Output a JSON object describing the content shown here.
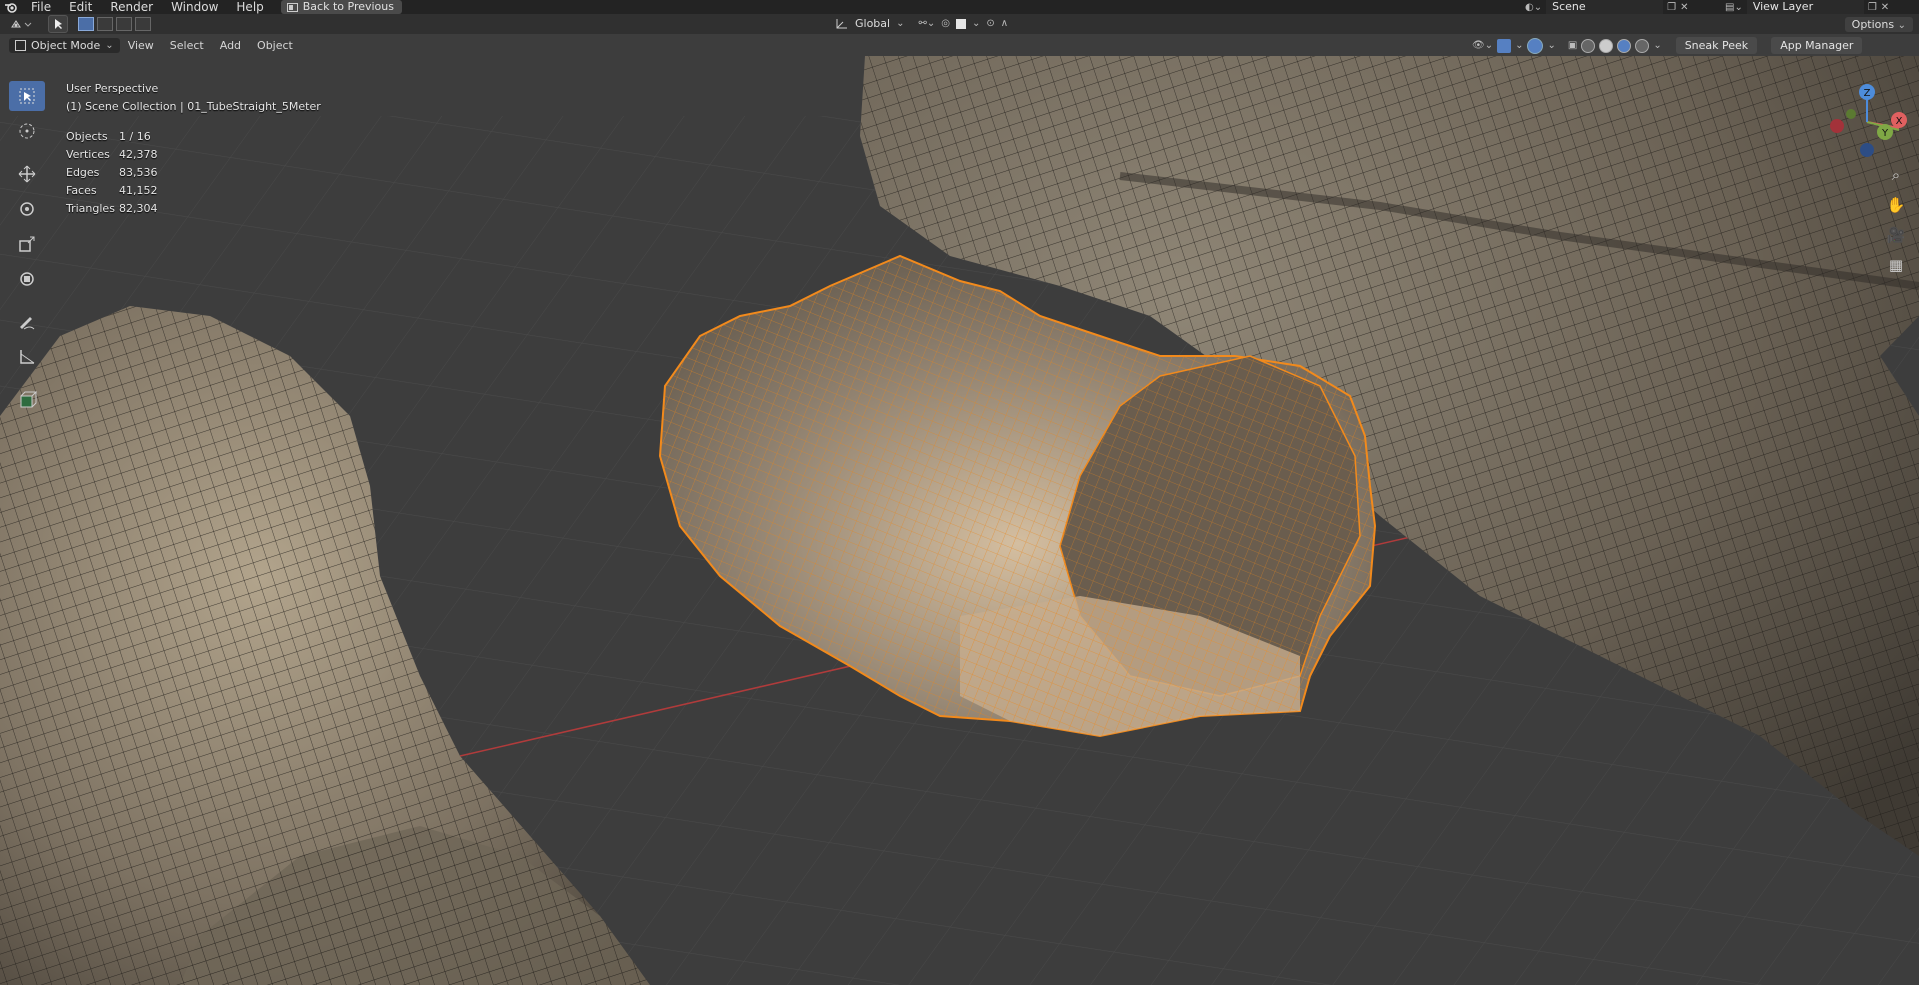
{
  "menu": [
    "File",
    "Edit",
    "Render",
    "Window",
    "Help"
  ],
  "back_to_previous": "Back to Previous",
  "scene": {
    "value": "Scene"
  },
  "view_layer": {
    "value": "View Layer"
  },
  "header": {
    "orientation": "Global",
    "options_label": "Options"
  },
  "viewport_header": {
    "mode": "Object Mode",
    "menus": [
      "View",
      "Select",
      "Add",
      "Object"
    ],
    "sneak_peek": "Sneak Peek",
    "app_manager": "App Manager"
  },
  "overlay_text": {
    "perspective": "User Perspective",
    "collection": "(1) Scene Collection | 01_TubeStraight_5Meter",
    "stats": [
      {
        "k": "Objects",
        "v": "1 / 16"
      },
      {
        "k": "Vertices",
        "v": "42,378"
      },
      {
        "k": "Edges",
        "v": "83,536"
      },
      {
        "k": "Faces",
        "v": "41,152"
      },
      {
        "k": "Triangles",
        "v": "82,304"
      }
    ]
  },
  "gizmo": {
    "x": "X",
    "y": "Y",
    "z": "Z"
  },
  "colors": {
    "selection": "#f28a1c",
    "accent": "#4b6ea7",
    "rock_light": "#a89a85",
    "rock_dark": "#564e44"
  },
  "tools": [
    "select-tool-icon",
    "cursor-tool-icon",
    "move-tool-icon",
    "rotate-tool-icon",
    "scale-tool-icon",
    "transform-tool-icon",
    "annotate-tool-icon",
    "measure-tool-icon",
    "add-cube-tool-icon"
  ]
}
